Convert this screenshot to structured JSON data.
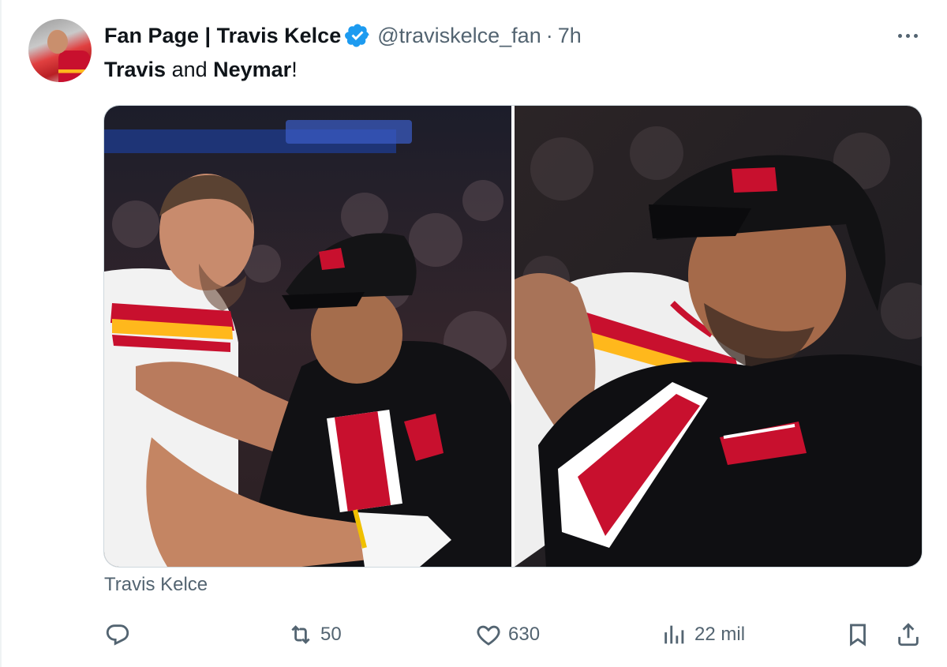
{
  "tweet": {
    "display_name": "Fan Page | Travis Kelce",
    "handle": "@traviskelce_fan",
    "separator": "·",
    "time": "7h",
    "text_parts": [
      "Travis",
      " and ",
      "Neymar",
      "!"
    ],
    "caption": "Travis Kelce",
    "verified_color": "#1d9bf0"
  },
  "media": {
    "photos": [
      {
        "kind": "photo",
        "subject": "photo-left"
      },
      {
        "kind": "photo",
        "subject": "photo-right"
      }
    ]
  },
  "actions": {
    "reply": {
      "icon": "reply-icon",
      "count": ""
    },
    "retweet": {
      "icon": "retweet-icon",
      "count": "50"
    },
    "like": {
      "icon": "heart-icon",
      "count": "630"
    },
    "views": {
      "icon": "views-icon",
      "count": "22 mil"
    },
    "bookmark": {
      "icon": "bookmark-icon"
    },
    "share": {
      "icon": "share-icon"
    }
  }
}
